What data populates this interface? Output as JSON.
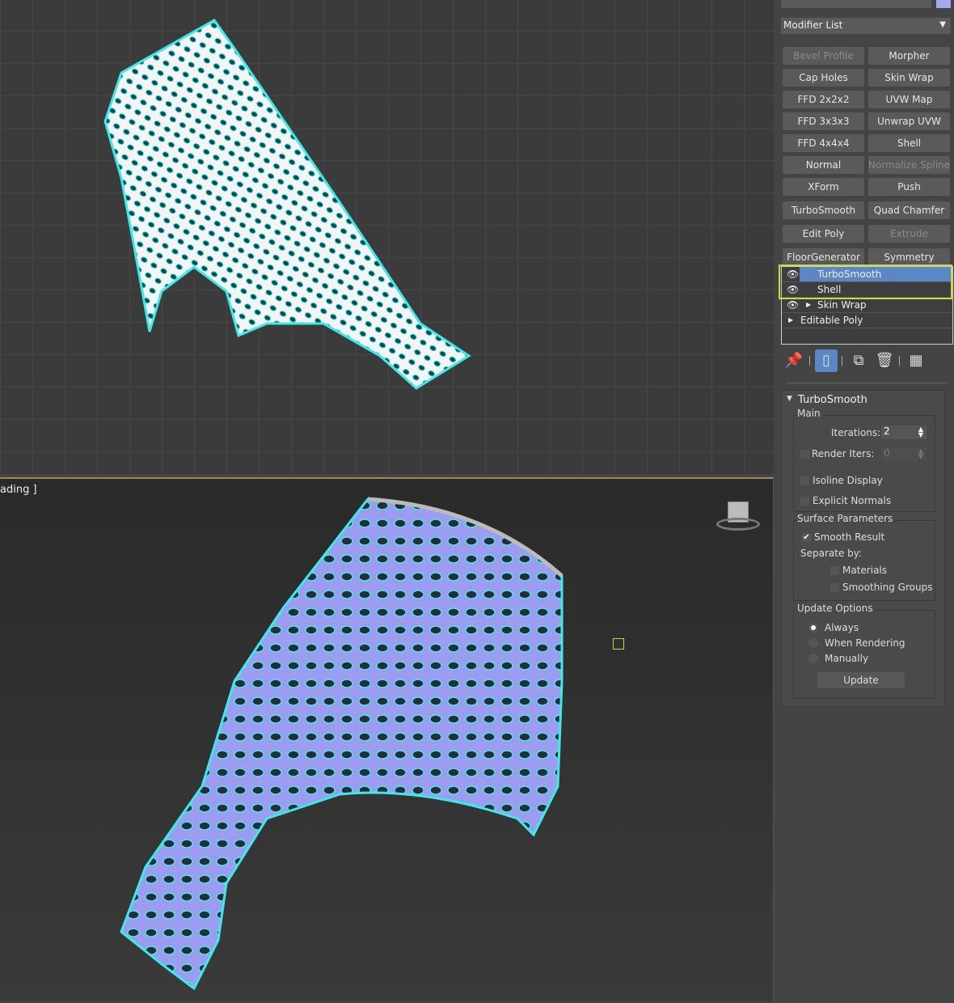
{
  "viewports": {
    "bottom_label": "ading ]"
  },
  "panel": {
    "modifier_list": "Modifier List",
    "buttons": [
      {
        "label": "Bevel Profile",
        "enabled": false
      },
      {
        "label": "Morpher",
        "enabled": true
      },
      {
        "label": "Cap Holes",
        "enabled": true
      },
      {
        "label": "Skin Wrap",
        "enabled": true
      },
      {
        "label": "FFD 2x2x2",
        "enabled": true
      },
      {
        "label": "UVW Map",
        "enabled": true
      },
      {
        "label": "FFD 3x3x3",
        "enabled": true
      },
      {
        "label": "Unwrap UVW",
        "enabled": true
      },
      {
        "label": "FFD 4x4x4",
        "enabled": true
      },
      {
        "label": "Shell",
        "enabled": true
      },
      {
        "label": "Normal",
        "enabled": true
      },
      {
        "label": "Normalize Spline",
        "enabled": false
      },
      {
        "label": "XForm",
        "enabled": true
      },
      {
        "label": "Push",
        "enabled": true
      },
      {
        "label": "TurboSmooth",
        "enabled": true
      },
      {
        "label": "Quad Chamfer",
        "enabled": true
      },
      {
        "label": "Edit Poly",
        "enabled": true
      },
      {
        "label": "Extrude",
        "enabled": false
      },
      {
        "label": "FloorGenerator",
        "enabled": true
      },
      {
        "label": "Symmetry",
        "enabled": true
      }
    ],
    "stack": [
      {
        "label": "TurboSmooth",
        "selected": true
      },
      {
        "label": "Shell",
        "selected": false
      },
      {
        "label": "Skin Wrap",
        "selected": false
      },
      {
        "label": "Editable Poly",
        "selected": false
      }
    ],
    "turbosmooth": {
      "title": "TurboSmooth",
      "main": "Main",
      "iterations_label": "Iterations:",
      "iterations": "2",
      "render_iters_label": "Render Iters:",
      "render_iters": "0",
      "render_iters_checked": false,
      "isoline": "Isoline Display",
      "isoline_checked": false,
      "explicit": "Explicit Normals",
      "explicit_checked": false,
      "surface": "Surface Parameters",
      "smooth_result": "Smooth Result",
      "smooth_result_checked": true,
      "separate_by": "Separate by:",
      "materials": "Materials",
      "smoothing_groups": "Smoothing Groups",
      "update_options": "Update Options",
      "always": "Always",
      "when_rendering": "When Rendering",
      "manually": "Manually",
      "selected_update": "Always",
      "update_button": "Update"
    }
  },
  "colors": {
    "selection_blue": "#5b87c5",
    "highlight": "#c8dc3c",
    "mesh": "#9c9cf0",
    "wire": "#40e8e8"
  }
}
